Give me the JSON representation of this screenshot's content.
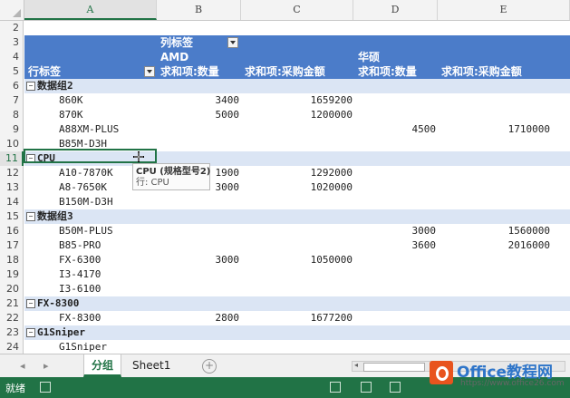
{
  "columns": [
    "A",
    "B",
    "C",
    "D",
    "E"
  ],
  "pivot_header": {
    "col_labels_caption": "列标签",
    "row_labels_caption": "行标签",
    "brand_amd": "AMD",
    "brand_asus": "华硕",
    "qty_label_amd": "求和项:数量",
    "amount_label_amd": "求和项:采购金额",
    "qty_label_asus": "求和项:数量",
    "amount_label_asus": "求和项:采购金额"
  },
  "rows": [
    {
      "n": "2",
      "kind": "blank"
    },
    {
      "n": "6",
      "kind": "group",
      "label": "数据组2"
    },
    {
      "n": "7",
      "kind": "item",
      "label": "860K",
      "b": "3400",
      "c": "1659200",
      "d": "",
      "e": ""
    },
    {
      "n": "8",
      "kind": "item",
      "label": "870K",
      "b": "5000",
      "c": "1200000",
      "d": "",
      "e": ""
    },
    {
      "n": "9",
      "kind": "item",
      "label": "A88XM-PLUS",
      "b": "",
      "c": "",
      "d": "4500",
      "e": "1710000"
    },
    {
      "n": "10",
      "kind": "item",
      "label": "B85M-D3H",
      "b": "",
      "c": "",
      "d": "",
      "e": ""
    },
    {
      "n": "11",
      "kind": "group",
      "label": "CPU"
    },
    {
      "n": "12",
      "kind": "item",
      "label": "A10-7870K",
      "b": "1900",
      "c": "1292000",
      "d": "",
      "e": ""
    },
    {
      "n": "13",
      "kind": "item",
      "label": "A8-7650K",
      "b": "3000",
      "c": "1020000",
      "d": "",
      "e": ""
    },
    {
      "n": "14",
      "kind": "item",
      "label": "B150M-D3H",
      "b": "",
      "c": "",
      "d": "",
      "e": ""
    },
    {
      "n": "15",
      "kind": "group",
      "label": "数据组3"
    },
    {
      "n": "16",
      "kind": "item",
      "label": "B50M-PLUS",
      "b": "",
      "c": "",
      "d": "3000",
      "e": "1560000"
    },
    {
      "n": "17",
      "kind": "item",
      "label": "B85-PRO",
      "b": "",
      "c": "",
      "d": "3600",
      "e": "2016000"
    },
    {
      "n": "18",
      "kind": "item",
      "label": "FX-6300",
      "b": "3000",
      "c": "1050000",
      "d": "",
      "e": ""
    },
    {
      "n": "19",
      "kind": "item",
      "label": "I3-4170",
      "b": "",
      "c": "",
      "d": "",
      "e": ""
    },
    {
      "n": "20",
      "kind": "item",
      "label": "I3-6100",
      "b": "",
      "c": "",
      "d": "",
      "e": ""
    },
    {
      "n": "21",
      "kind": "group",
      "label": "FX-8300"
    },
    {
      "n": "22",
      "kind": "item",
      "label": "FX-8300",
      "b": "2800",
      "c": "1677200",
      "d": "",
      "e": ""
    },
    {
      "n": "23",
      "kind": "group",
      "label": "G1Sniper"
    },
    {
      "n": "24",
      "kind": "item",
      "label": "G1Sniper",
      "b": "",
      "c": "",
      "d": "",
      "e": ""
    }
  ],
  "header_row_numbers": [
    "3",
    "4",
    "5"
  ],
  "selected_row": "11",
  "tooltip": {
    "line1": "CPU (规格型号2)",
    "line2": "行: CPU"
  },
  "sheet_tabs": [
    "分组",
    "Sheet1"
  ],
  "active_tab": "分组",
  "status": {
    "ready": "就绪"
  },
  "watermark": {
    "name": "Office教程网",
    "url": "https://www.office26.com"
  },
  "colors": {
    "accent": "#217346",
    "pivot_header": "#4b7cc9",
    "group_row": "#dbe5f4"
  }
}
